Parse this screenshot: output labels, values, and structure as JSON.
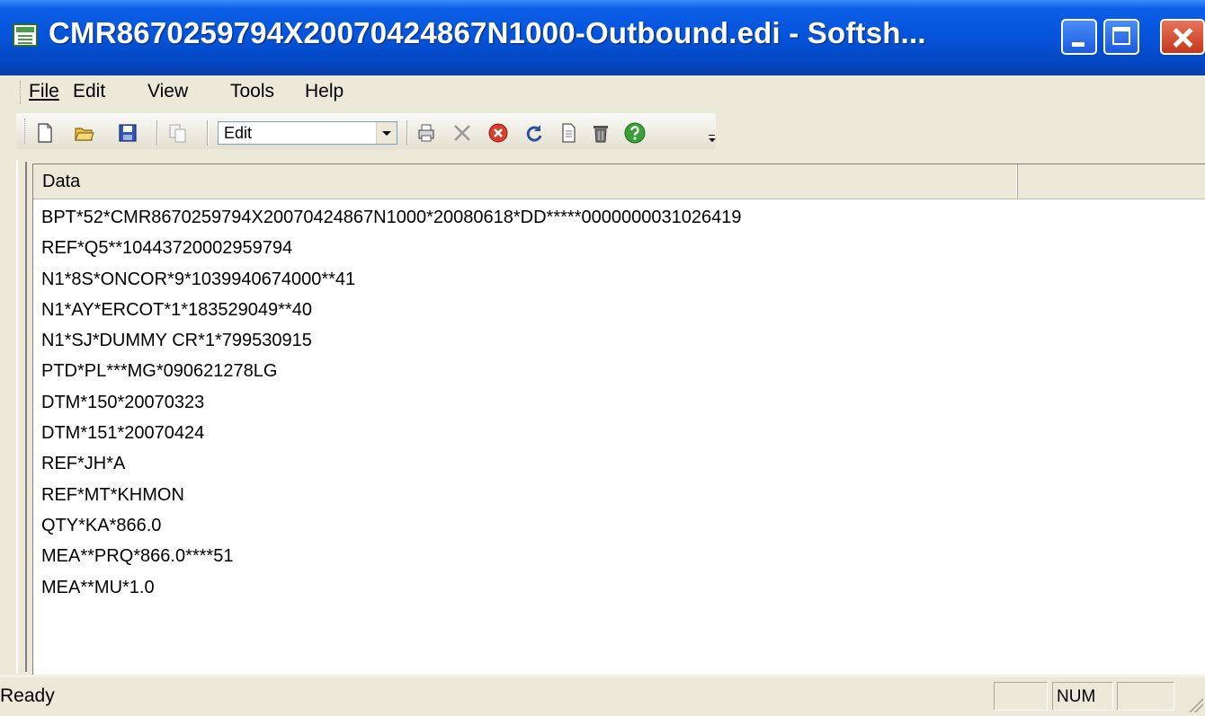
{
  "window": {
    "title": "CMR8670259794X20070424867N1000-Outbound.edi - Softsh..."
  },
  "menu": [
    "File",
    "Edit",
    "View",
    "Tools",
    "Help"
  ],
  "toolbar": {
    "mode_select_value": "Edit"
  },
  "grid": {
    "column_header": "Data",
    "lines": [
      "BPT*52*CMR8670259794X20070424867N1000*20080618*DD*****0000000031026419",
      "REF*Q5**10443720002959794",
      "N1*8S*ONCOR*9*1039940674000**41",
      "N1*AY*ERCOT*1*183529049**40",
      "N1*SJ*DUMMY CR*1*799530915",
      "PTD*PL***MG*090621278LG",
      "DTM*150*20070323",
      "DTM*151*20070424",
      "REF*JH*A",
      "REF*MT*KHMON",
      "QTY*KA*866.0",
      "MEA**PRQ*866.0****51",
      "MEA**MU*1.0"
    ]
  },
  "status": {
    "text": "Ready",
    "num_indicator": "NUM"
  }
}
